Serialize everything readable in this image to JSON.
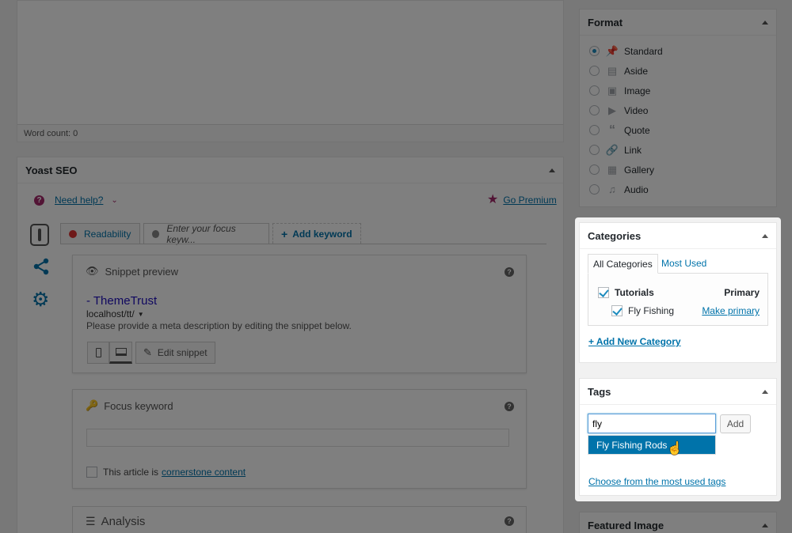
{
  "editor": {
    "word_count": "Word count: 0"
  },
  "yoast": {
    "title": "Yoast SEO",
    "need_help": "Need help?",
    "go_premium": "Go Premium",
    "tabs": [
      {
        "label": "Readability",
        "status_color": "#dc3232"
      },
      {
        "label": "Enter your focus keyw...",
        "status_color": "#888888"
      },
      {
        "label": "Add keyword"
      }
    ],
    "snippet": {
      "heading": "Snippet preview",
      "title": "- ThemeTrust",
      "url": "localhost/tt/",
      "description": "Please provide a meta description by editing the snippet below.",
      "edit_button": "Edit snippet"
    },
    "focus": {
      "heading": "Focus keyword",
      "value": "",
      "cornerstone_prefix": "This article is",
      "cornerstone_link": "cornerstone content"
    },
    "analysis": {
      "heading": "Analysis"
    }
  },
  "format": {
    "title": "Format",
    "options": [
      {
        "label": "Standard",
        "icon": "pin-icon",
        "selected": true
      },
      {
        "label": "Aside",
        "icon": "aside-icon",
        "selected": false
      },
      {
        "label": "Image",
        "icon": "image-icon",
        "selected": false
      },
      {
        "label": "Video",
        "icon": "video-icon",
        "selected": false
      },
      {
        "label": "Quote",
        "icon": "quote-icon",
        "selected": false
      },
      {
        "label": "Link",
        "icon": "link-icon",
        "selected": false
      },
      {
        "label": "Gallery",
        "icon": "gallery-icon",
        "selected": false
      },
      {
        "label": "Audio",
        "icon": "audio-icon",
        "selected": false
      }
    ]
  },
  "categories": {
    "title": "Categories",
    "tab_all": "All Categories",
    "tab_most_used": "Most Used",
    "items": [
      {
        "label": "Tutorials",
        "checked": true,
        "action": "Primary"
      },
      {
        "label": "Fly Fishing",
        "checked": true,
        "action": "Make primary"
      }
    ],
    "add_new": "+ Add New Category"
  },
  "tags": {
    "title": "Tags",
    "input_value": "fly",
    "add_button": "Add",
    "suggestion": "Fly Fishing Rods",
    "choose_link": "Choose from the most used tags"
  },
  "featured_image": {
    "title": "Featured Image"
  },
  "colors": {
    "accent": "#0073aa",
    "suggestion_bg": "#0073aa",
    "premium": "#a4286a"
  }
}
